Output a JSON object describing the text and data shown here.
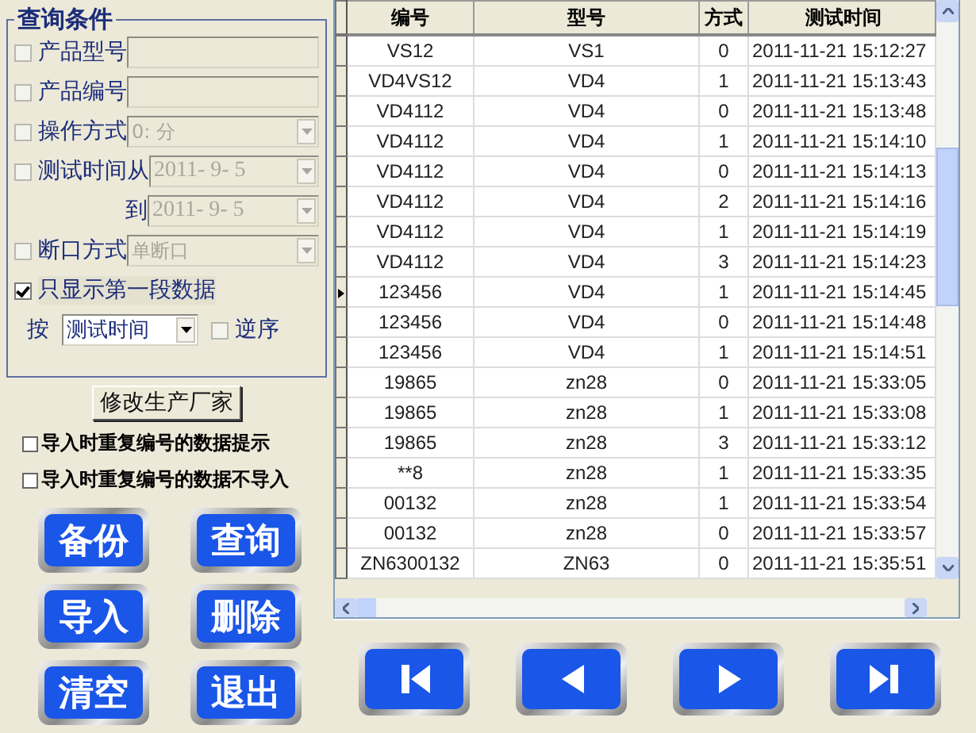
{
  "filter": {
    "title": "查询条件",
    "conditions": [
      {
        "kind": "text",
        "label": "产品型号",
        "checked": false,
        "disabled": true
      },
      {
        "kind": "text",
        "label": "产品编号",
        "checked": false,
        "disabled": true
      },
      {
        "kind": "select",
        "label": "操作方式",
        "checked": false,
        "disabled": true,
        "value": "0: 分"
      },
      {
        "kind": "date",
        "label": "测试时间从",
        "checked": false,
        "disabled": true,
        "value": "2011- 9- 5"
      },
      {
        "kind": "date_to",
        "label": "到",
        "disabled": true,
        "value": "2011- 9- 5"
      },
      {
        "kind": "select",
        "label": "断口方式",
        "checked": false,
        "disabled": true,
        "value": "单断口"
      },
      {
        "kind": "flag",
        "label": "只显示第一段数据",
        "checked": true
      }
    ],
    "sort": {
      "label": "按",
      "value": "测试时间",
      "reverse_label": "逆序",
      "reverse_checked": false
    }
  },
  "manufacturer_button": "修改生产厂家",
  "import_options": [
    {
      "label": "导入时重复编号的数据提示",
      "checked": false
    },
    {
      "label": "导入时重复编号的数据不导入",
      "checked": false
    }
  ],
  "actions": [
    "备份",
    "查询",
    "导入",
    "删除",
    "清空",
    "退出"
  ],
  "table": {
    "columns": [
      "编号",
      "型号",
      "方式",
      "测试时间"
    ],
    "rows": [
      {
        "cells": [
          "VS12",
          "VS1",
          "0",
          "2011-11-21 15:12:27"
        ],
        "selected": false
      },
      {
        "cells": [
          "VD4VS12",
          "VD4",
          "1",
          "2011-11-21 15:13:43"
        ],
        "selected": false
      },
      {
        "cells": [
          "VD4112",
          "VD4",
          "0",
          "2011-11-21 15:13:48"
        ],
        "selected": false
      },
      {
        "cells": [
          "VD4112",
          "VD4",
          "1",
          "2011-11-21 15:14:10"
        ],
        "selected": false
      },
      {
        "cells": [
          "VD4112",
          "VD4",
          "0",
          "2011-11-21 15:14:13"
        ],
        "selected": false
      },
      {
        "cells": [
          "VD4112",
          "VD4",
          "2",
          "2011-11-21 15:14:16"
        ],
        "selected": false
      },
      {
        "cells": [
          "VD4112",
          "VD4",
          "1",
          "2011-11-21 15:14:19"
        ],
        "selected": false
      },
      {
        "cells": [
          "VD4112",
          "VD4",
          "3",
          "2011-11-21 15:14:23"
        ],
        "selected": false
      },
      {
        "cells": [
          "123456",
          "VD4",
          "1",
          "2011-11-21 15:14:45"
        ],
        "selected": true
      },
      {
        "cells": [
          "123456",
          "VD4",
          "0",
          "2011-11-21 15:14:48"
        ],
        "selected": false
      },
      {
        "cells": [
          "123456",
          "VD4",
          "1",
          "2011-11-21 15:14:51"
        ],
        "selected": false
      },
      {
        "cells": [
          "19865",
          "zn28",
          "0",
          "2011-11-21 15:33:05"
        ],
        "selected": false
      },
      {
        "cells": [
          "19865",
          "zn28",
          "1",
          "2011-11-21 15:33:08"
        ],
        "selected": false
      },
      {
        "cells": [
          "19865",
          "zn28",
          "3",
          "2011-11-21 15:33:12"
        ],
        "selected": false
      },
      {
        "cells": [
          "**8",
          "zn28",
          "1",
          "2011-11-21 15:33:35"
        ],
        "selected": false
      },
      {
        "cells": [
          "00132",
          "zn28",
          "1",
          "2011-11-21 15:33:54"
        ],
        "selected": false
      },
      {
        "cells": [
          "00132",
          "zn28",
          "0",
          "2011-11-21 15:33:57"
        ],
        "selected": false
      },
      {
        "cells": [
          "ZN6300132",
          "ZN63",
          "0",
          "2011-11-21 15:35:51"
        ],
        "selected": false
      }
    ]
  },
  "nav_buttons": [
    {
      "kind": "first"
    },
    {
      "kind": "prev"
    },
    {
      "kind": "next"
    },
    {
      "kind": "last"
    }
  ]
}
